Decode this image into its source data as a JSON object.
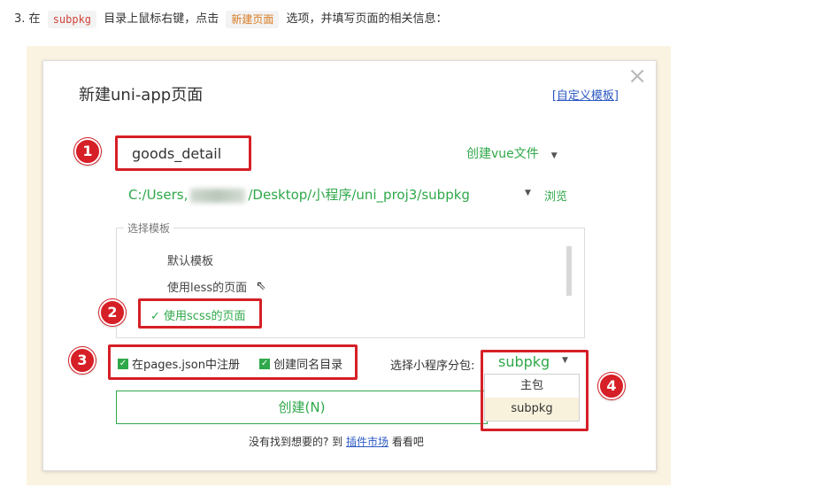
{
  "instruction": {
    "step_prefix": "3. 在",
    "code_subpkg": "subpkg",
    "mid_text": "目录上鼠标右键，点击",
    "code_new_page": "新建页面",
    "end_text": "选项，并填写页面的相关信息："
  },
  "dialog": {
    "title": "新建uni-app页面",
    "custom_template_link": "自定义模板",
    "close_icon": "×",
    "page_name_value": "goods_detail",
    "vue_select_label": "创建vue文件",
    "path_prefix": "C:/Users,",
    "path_suffix": "/Desktop/小程序/uni_proj3/subpkg",
    "browse_label": "浏览",
    "template_section": {
      "legend": "选择模板",
      "items": [
        "默认模板",
        "使用less的页面",
        "使用scss的页面"
      ],
      "selected_index": 2
    },
    "checkbox_register": "在pages.json中注册",
    "checkbox_same_dir": "创建同名目录",
    "subpackage_label": "选择小程序分包:",
    "subpackage_value": "subpkg",
    "subpackage_options": [
      "主包",
      "subpkg"
    ],
    "create_button": "创建(N)",
    "footer_text": "没有找到想要的? 到",
    "footer_link": "插件市场",
    "footer_tail": "看看吧"
  },
  "callouts": [
    "1",
    "2",
    "3",
    "4"
  ],
  "colors": {
    "accent_green": "#2fa84a",
    "highlight_red": "#d61f26",
    "link_blue": "#2b59c3",
    "backdrop": "#fbf3e2"
  }
}
